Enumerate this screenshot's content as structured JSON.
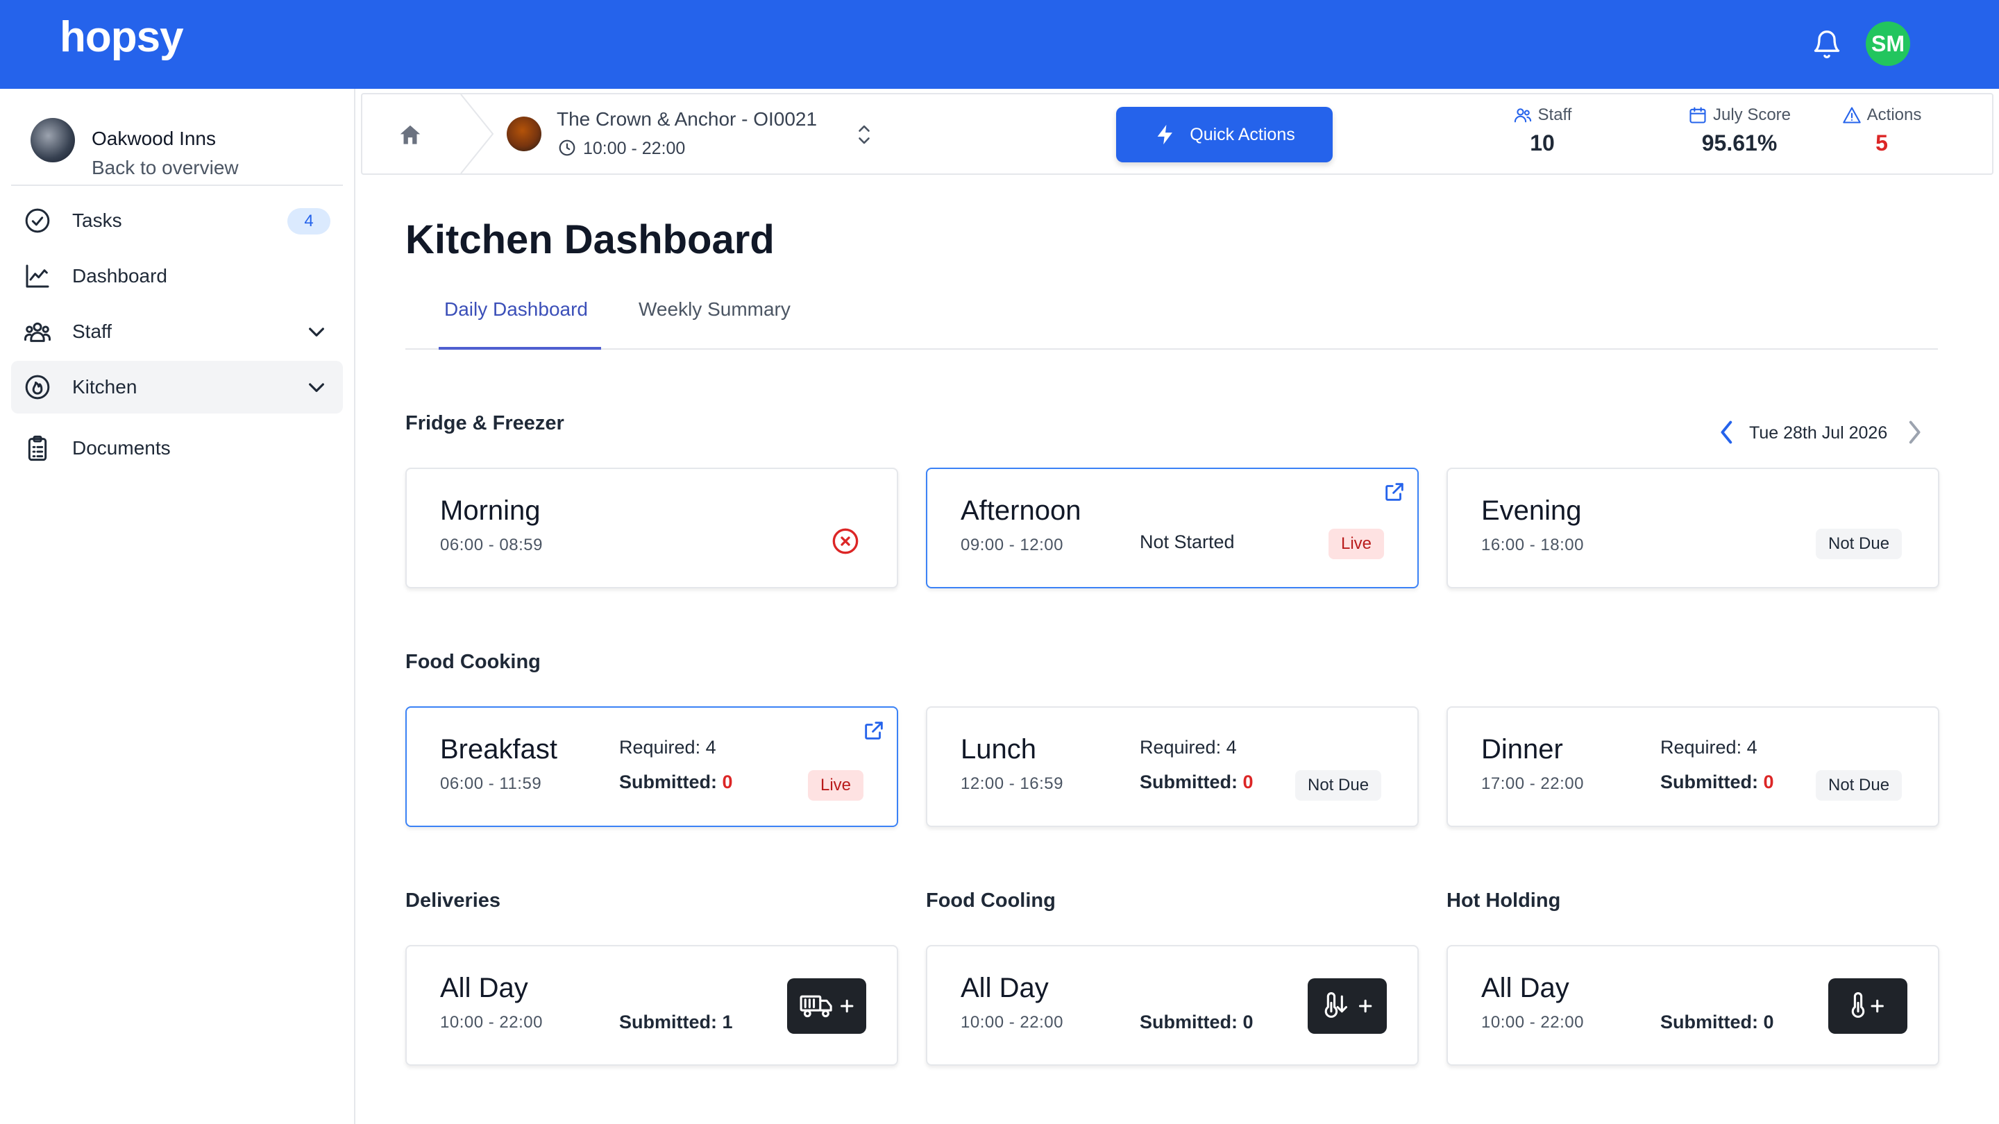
{
  "app": {
    "logo": "hopsy",
    "user_initials": "SM"
  },
  "sidebar": {
    "org_name": "Oakwood Inns",
    "back_label": "Back to overview",
    "items": [
      {
        "label": "Tasks",
        "badge": "4"
      },
      {
        "label": "Dashboard"
      },
      {
        "label": "Staff"
      },
      {
        "label": "Kitchen"
      },
      {
        "label": "Documents"
      }
    ]
  },
  "header": {
    "site_name": "The Crown & Anchor - OI0021",
    "site_hours": "10:00 - 22:00",
    "quick_actions": "Quick Actions",
    "stats": [
      {
        "label": "Staff",
        "value": "10"
      },
      {
        "label": "July Score",
        "value": "95.61%"
      },
      {
        "label": "Actions",
        "value": "5"
      }
    ]
  },
  "page": {
    "title": "Kitchen Dashboard",
    "tabs": [
      "Daily Dashboard",
      "Weekly Summary"
    ],
    "date": "Tue 28th Jul 2026"
  },
  "sections": {
    "fridge": {
      "title": "Fridge & Freezer",
      "cards": [
        {
          "title": "Morning",
          "time": "06:00 - 08:59"
        },
        {
          "title": "Afternoon",
          "time": "09:00 - 12:00",
          "status_text": "Not Started",
          "pill": "Live"
        },
        {
          "title": "Evening",
          "time": "16:00 - 18:00",
          "pill": "Not Due"
        }
      ]
    },
    "cooking": {
      "title": "Food Cooking",
      "required_label": "Required:",
      "submitted_label": "Submitted:",
      "cards": [
        {
          "title": "Breakfast",
          "time": "06:00 - 11:59",
          "required": "4",
          "submitted": "0",
          "pill": "Live"
        },
        {
          "title": "Lunch",
          "time": "12:00 - 16:59",
          "required": "4",
          "submitted": "0",
          "pill": "Not Due"
        },
        {
          "title": "Dinner",
          "time": "17:00 - 22:00",
          "required": "4",
          "submitted": "0",
          "pill": "Not Due"
        }
      ]
    },
    "deliveries": {
      "title": "Deliveries",
      "card": {
        "title": "All Day",
        "time": "10:00 - 22:00",
        "submitted": "Submitted: 1"
      }
    },
    "cooling": {
      "title": "Food Cooling",
      "card": {
        "title": "All Day",
        "time": "10:00 - 22:00",
        "submitted": "Submitted: 0"
      }
    },
    "hotholding": {
      "title": "Hot Holding",
      "card": {
        "title": "All Day",
        "time": "10:00 - 22:00",
        "submitted": "Submitted: 0"
      }
    }
  },
  "colors": {
    "brand": "#2563eb",
    "danger": "#dc2626",
    "live_bg": "#fee2e2",
    "success": "#22c55e"
  }
}
